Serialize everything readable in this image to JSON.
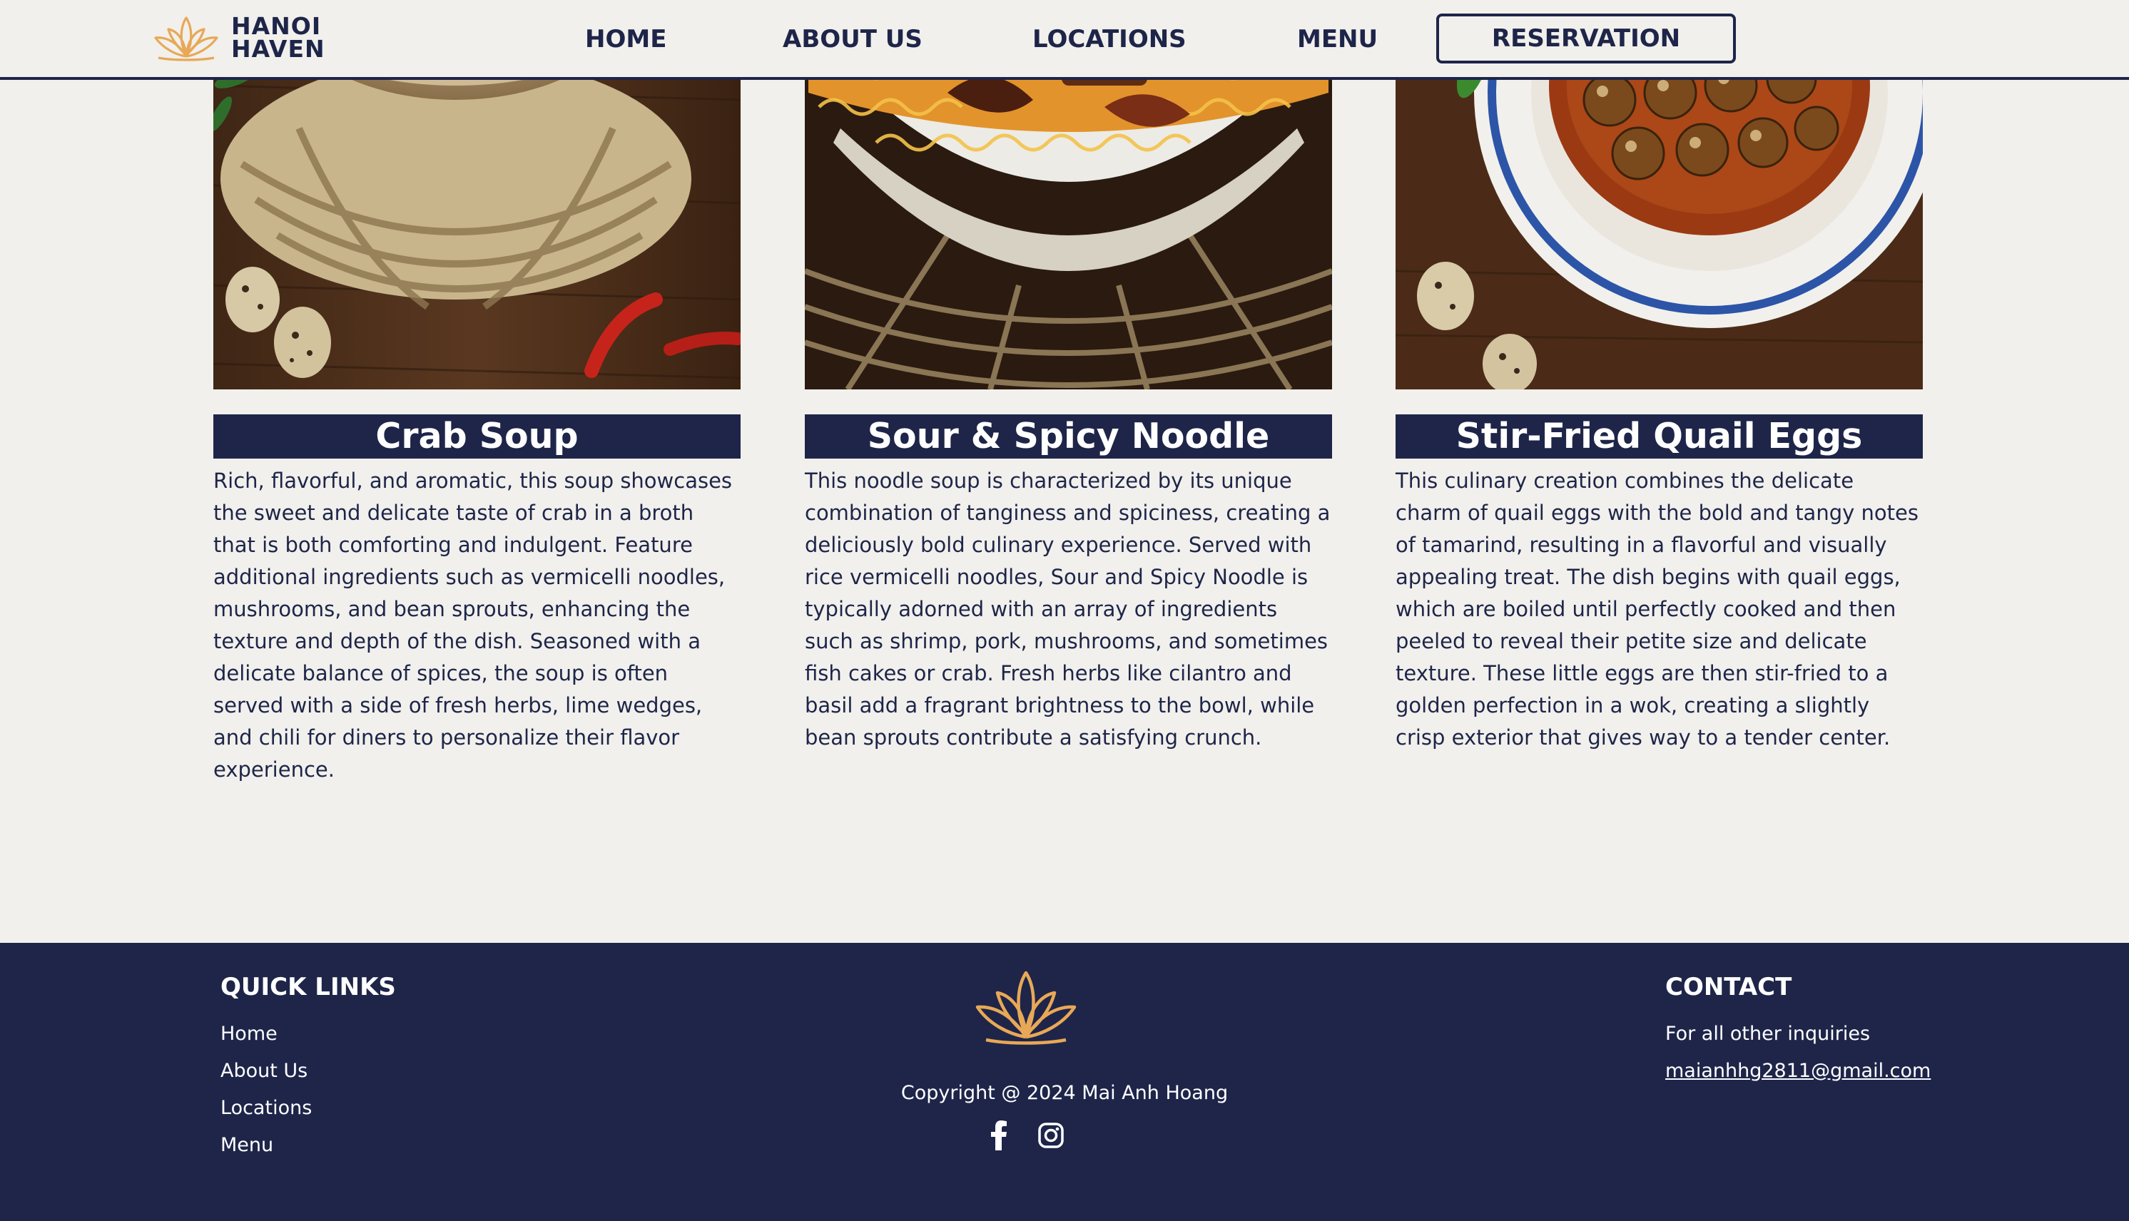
{
  "brand": {
    "line1": "HANOI",
    "line2": "HAVEN",
    "accent_color": "#e8a857",
    "primary_color": "#1e2549",
    "logo_icon": "lotus-icon"
  },
  "nav": {
    "home": "HOME",
    "about": "ABOUT US",
    "locations": "LOCATIONS",
    "menu": "MENU",
    "reservation": "RESERVATION"
  },
  "dishes": [
    {
      "title": "Crab Soup",
      "description": "Rich, flavorful, and aromatic, this soup showcases the sweet and delicate taste of crab in a broth that is both comforting and indulgent. Feature additional ingredients such as vermicelli noodles, mushrooms, and bean sprouts, enhancing the texture and depth of the dish. Seasoned with a delicate balance of spices, the soup is often served with a side of fresh herbs, lime wedges, and chili for diners to personalize their flavor experience."
    },
    {
      "title": "Sour & Spicy Noodle",
      "description": "This noodle soup is characterized by its unique combination of tanginess and spiciness, creating a deliciously bold culinary experience. Served with rice vermicelli noodles, Sour and Spicy Noodle is typically adorned with an array of ingredients such as shrimp, pork, mushrooms, and sometimes fish cakes or crab. Fresh herbs like cilantro and basil add a fragrant brightness to the bowl, while bean sprouts contribute a satisfying crunch."
    },
    {
      "title": "Stir-Fried Quail Eggs",
      "description": "This culinary creation combines the delicate charm of quail eggs with the bold and tangy notes of tamarind, resulting in a flavorful and visually appealing treat. The dish begins with quail eggs, which are boiled until perfectly cooked and then peeled to reveal their petite size and delicate texture. These little eggs are then stir-fried to a golden perfection in a wok, creating a slightly crisp exterior that gives way to a tender center."
    }
  ],
  "footer": {
    "quick_links_heading": "QUICK LINKS",
    "quick_links": [
      "Home",
      "About Us",
      "Locations",
      "Menu"
    ],
    "copyright": "Copyright @ 2024 Mai Anh Hoang",
    "contact_heading": "CONTACT",
    "contact_note": "For all other inquiries",
    "email": "maianhhg2811@gmail.com",
    "social_icons": [
      "facebook-icon",
      "instagram-icon"
    ]
  }
}
